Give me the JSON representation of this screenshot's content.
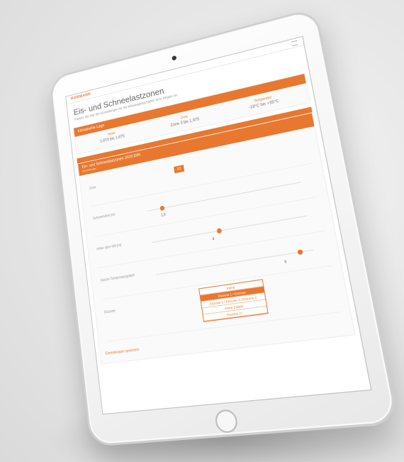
{
  "header": {
    "logo": "HORMANN",
    "title": "Eis- und Schneelastzonen",
    "description": "Passen Sie hier die Einstellungen für die Klimaeigenschaften ihrer Region an."
  },
  "summary": {
    "heading": "Klimatische Lage",
    "stats": [
      {
        "label": "Höhe",
        "value": "1.873 bis 1.875"
      },
      {
        "label": "Zone",
        "value": "Zone 3 bis 1.975"
      },
      {
        "label": "Temperatur",
        "value": "-18°C bis +35°C"
      }
    ]
  },
  "form": {
    "heading": "Ein- und Schneelastzonen 2020 DIN",
    "subheading": "Einstellungen",
    "rows": [
      {
        "label": "Zone",
        "badge": "1/2"
      },
      {
        "label": "Schneehöhe [m]",
        "value": "1,5",
        "level": 0.1
      },
      {
        "label": "Höhe über NN [m]",
        "value": "4",
        "level": 0.45
      },
      {
        "label": "Ganze Temperaturgebiet",
        "value": "6",
        "level": 0.92
      },
      {
        "label": "Eiszone"
      }
    ],
    "options": [
      "Keine",
      "Eiszone 1 / Eiszone",
      "Eiszone 2 / Eiszone 3 / Eiszone 4",
      "Keine Eislast",
      "Eiszone 1+"
    ],
    "selected_option": 1,
    "footer_link": "Einstellungen speichern"
  },
  "colors": {
    "accent": "#e8782f"
  }
}
